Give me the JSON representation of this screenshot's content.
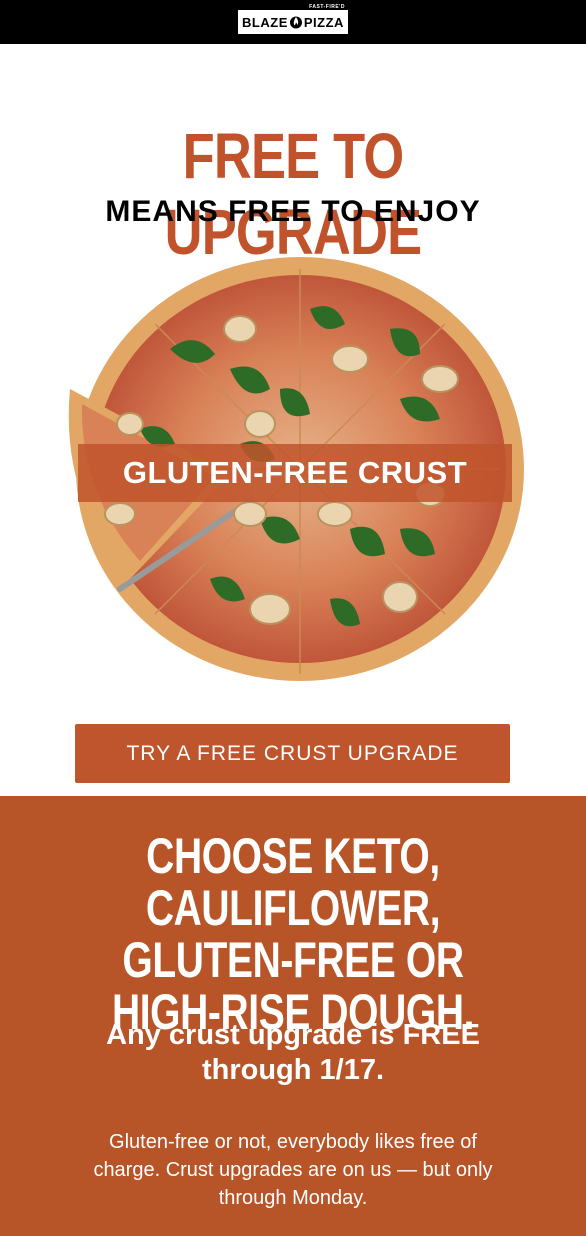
{
  "logo": {
    "word_left": "BLAZE",
    "word_right": "PIZZA",
    "tagline": "FAST-FIRE'D"
  },
  "hero": {
    "headline": "FREE TO UPGRADE",
    "subhead": "MEANS FREE TO ENJOY",
    "banner": "GLUTEN-FREE CRUST",
    "cta": "TRY A FREE CRUST UPGRADE"
  },
  "promo": {
    "headline_lines": [
      "CHOOSE KETO, CAULIFLOWER,",
      "GLUTEN-FREE OR",
      "HIGH-RISE DOUGH."
    ],
    "sub_lines": [
      "Any crust upgrade is FREE",
      "through 1/17."
    ],
    "body_lines": [
      "Gluten-free or not, everybody likes free of",
      "charge. Crust upgrades are on us — but only",
      "through Monday."
    ]
  },
  "colors": {
    "brand": "#c0532c",
    "promo_bg": "#b75428",
    "topbar": "#000000"
  }
}
